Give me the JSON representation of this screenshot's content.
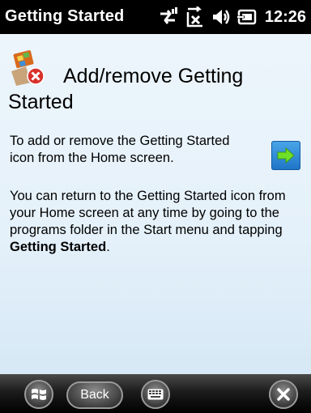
{
  "titlebar": {
    "title": "Getting Started",
    "clock": "12:26",
    "icons": [
      "connectivity-icon",
      "signal-off-icon",
      "volume-icon",
      "battery-charging-icon"
    ]
  },
  "content": {
    "icon": "getting-started-remove-icon",
    "title": "Add/remove Getting Started",
    "description": "To add or remove the Getting Started icon from the Home screen.",
    "action_icon": "arrow-right-icon",
    "info_text_before": "You can return to the Getting Started icon from your Home screen at any time by going to the programs folder in the Start menu and tapping ",
    "info_text_bold": "Getting Started",
    "info_text_after": "."
  },
  "bottombar": {
    "start_icon": "windows-start-icon",
    "back_label": "Back",
    "keyboard_icon": "keyboard-icon",
    "close_icon": "close-icon"
  },
  "colors": {
    "titlebar_bg": "#000000",
    "content_bg": "#e5f1fa",
    "arrow_button": "#2a86d6",
    "arrow_green": "#5fd21e"
  }
}
